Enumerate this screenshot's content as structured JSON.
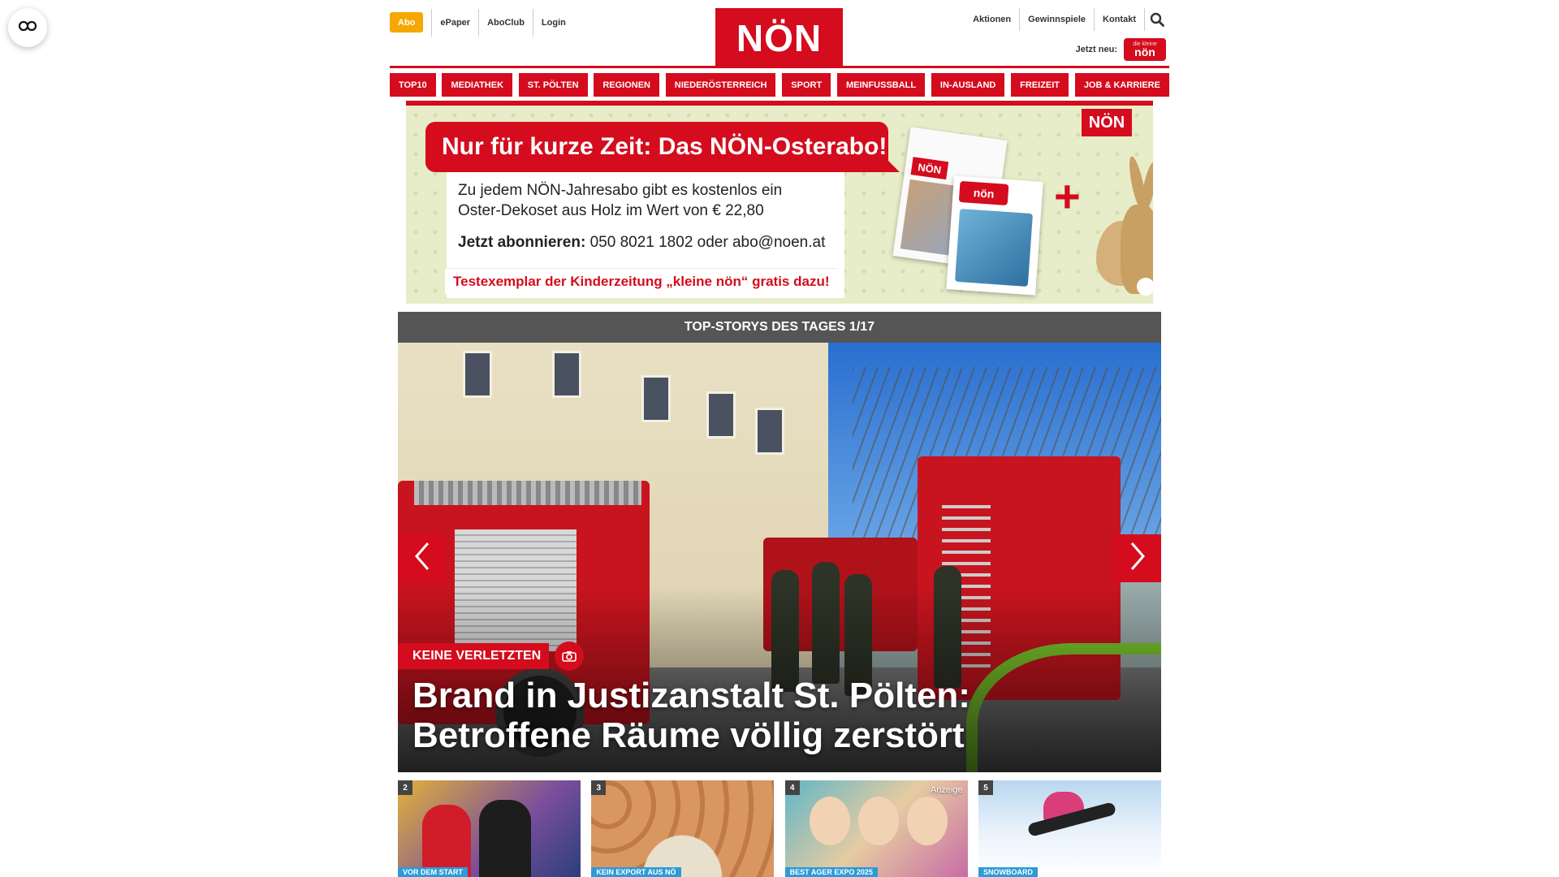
{
  "header": {
    "abo_label": "Abo",
    "top_left_links": [
      "ePaper",
      "AboClub",
      "Login"
    ],
    "logo_text": "NÖN",
    "top_right_links": [
      "Aktionen",
      "Gewinnspiele",
      "Kontakt"
    ],
    "jetzt_neu_label": "Jetzt neu:",
    "kleine_noen_top": "die kleine",
    "kleine_noen_main": "nön"
  },
  "nav": {
    "items": [
      "TOP10",
      "MEDIATHEK",
      "ST. PÖLTEN",
      "REGIONEN",
      "NIEDERÖSTERREICH",
      "SPORT",
      "MEINFUSSBALL",
      "IN-AUSLAND",
      "FREIZEIT",
      "JOB & KARRIERE"
    ]
  },
  "promo": {
    "headline": "Nur für kurze Zeit: Das NÖN-Osterabo!",
    "text_line1": "Zu jedem NÖN-Jahresabo gibt es kostenlos ein",
    "text_line2": "Oster-Dekoset aus Holz im Wert von € 22,80",
    "contact_bold": "Jetzt abonnieren:",
    "contact_rest": " 050 8021 1802 oder abo@noen.at",
    "free_sample": "Testexemplar der Kinderzeitung „kleine nön“ gratis dazu!",
    "brand": "NÖN",
    "plus": "+",
    "paper1_brand": "NÖN",
    "paper2_brand": "nön"
  },
  "top_stories": {
    "bar_label": "TOP-STORYS DES TAGES 1/17",
    "hero": {
      "label": "KEINE VERLETZTEN",
      "title_line1": "Brand in Justizanstalt St. Pölten:",
      "title_line2": "Betroffene Räume völlig zerstört"
    },
    "thumbs": [
      {
        "num": "2",
        "tag": "VOR DEM START",
        "ad": ""
      },
      {
        "num": "3",
        "tag": "KEIN EXPORT AUS NÖ",
        "ad": ""
      },
      {
        "num": "4",
        "tag": "BEST AGER EXPO 2025",
        "ad": "Anzeige"
      },
      {
        "num": "5",
        "tag": "SNOWBOARD",
        "ad": ""
      }
    ]
  },
  "colors": {
    "brand_red": "#d40c1d",
    "abo_orange": "#f5a800",
    "topstories_bar": "#555555",
    "tag_blue": "#2c9bd6"
  },
  "icons": {
    "accessibility": "glasses-icon",
    "search": "search-icon",
    "prev": "chevron-left-icon",
    "next": "chevron-right-icon",
    "gallery": "camera-icon"
  }
}
